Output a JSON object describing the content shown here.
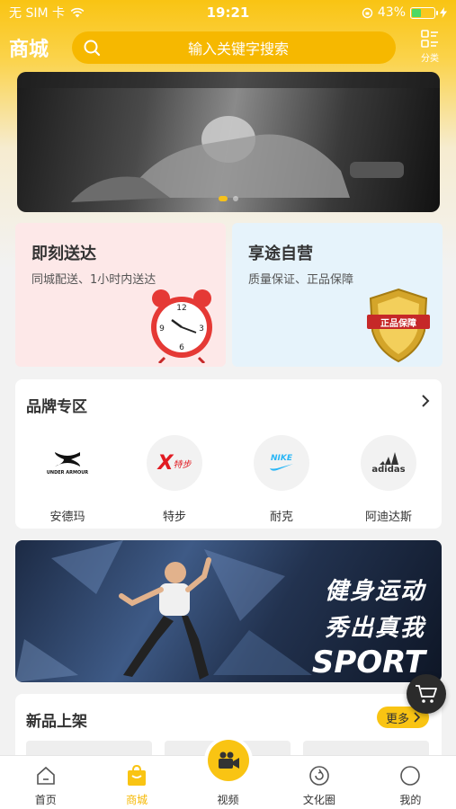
{
  "status_bar": {
    "carrier": "无 SIM 卡",
    "time": "19:21",
    "battery": "43%",
    "battery_level": 0.43
  },
  "header": {
    "title": "商城",
    "search_placeholder": "输入关键字搜索",
    "category_label": "分类"
  },
  "promos": [
    {
      "title": "即刻送达",
      "subtitle": "同城配送、1小时内送达",
      "icon": "alarm-clock-icon"
    },
    {
      "title": "享途自营",
      "subtitle": "质量保证、正品保障",
      "icon": "shield-badge-icon",
      "badge_text": "正品保障"
    }
  ],
  "brands": {
    "title": "品牌专区",
    "items": [
      {
        "name": "安德玛",
        "logo_text": "UNDER ARMOUR"
      },
      {
        "name": "特步",
        "logo_text": "特步"
      },
      {
        "name": "耐克",
        "logo_text": "NIKE"
      },
      {
        "name": "阿迪达斯",
        "logo_text": "adidas"
      }
    ]
  },
  "sport_banner": {
    "line1": "健身运动",
    "line2": "秀出真我",
    "line3": "SPORT"
  },
  "new_products": {
    "title": "新品上架",
    "more_label": "更多"
  },
  "tabbar": {
    "items": [
      {
        "label": "首页"
      },
      {
        "label": "商城"
      },
      {
        "label": "视频"
      },
      {
        "label": "文化圈"
      },
      {
        "label": "我的"
      }
    ],
    "active_index": 1
  },
  "colors": {
    "accent": "#f9c413",
    "search_bg": "#f6b800"
  }
}
